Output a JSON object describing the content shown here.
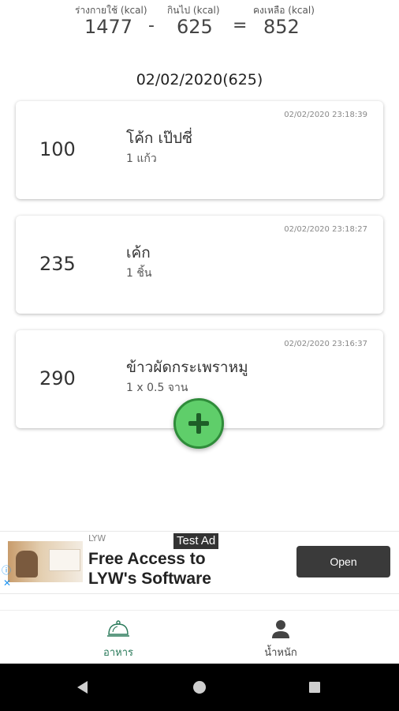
{
  "summary": {
    "body_label": "ร่างกายใช้ (kcal)",
    "eaten_label": "กินไป (kcal)",
    "remaining_label": "คงเหลือ (kcal)",
    "body_value": "1477",
    "eaten_value": "625",
    "remaining_value": "852",
    "minus": "-",
    "equals": "="
  },
  "date_header": "02/02/2020(625)",
  "entries": [
    {
      "kcal": "100",
      "name": "โค้ก เป๊ปซี่",
      "qty": "1 แก้ว",
      "time": "02/02/2020 23:18:39"
    },
    {
      "kcal": "235",
      "name": "เค้ก",
      "qty": "1 ชิ้น",
      "time": "02/02/2020 23:18:27"
    },
    {
      "kcal": "290",
      "name": "ข้าวผัดกระเพราหมู",
      "qty": "1 x 0.5 จาน",
      "time": "02/02/2020 23:16:37"
    }
  ],
  "ad": {
    "tag": "Test Ad",
    "source": "LYW",
    "title": "Free Access to LYW's Software",
    "button": "Open",
    "info_icon": "ⓘ",
    "close_icon": "✕"
  },
  "nav": {
    "food_label": "อาหาร",
    "weight_label": "น้ำหนัก"
  },
  "colors": {
    "fab": "#5fce6a",
    "fab_border": "#2f8c3a",
    "nav_active": "#2a7a5a"
  }
}
